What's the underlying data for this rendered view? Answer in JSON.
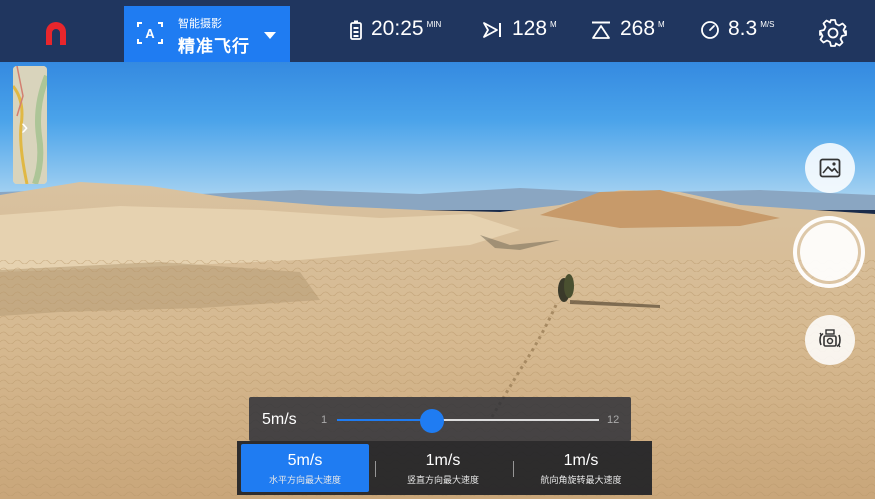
{
  "header": {
    "mode_small": "智能摄影",
    "mode_big": "精准飞行",
    "mode_icon_letter": "A",
    "battery": {
      "value": "20:25",
      "unit": "MIN",
      "icon": "battery-icon"
    },
    "distance": {
      "value": "128",
      "unit": "M",
      "icon": "distance-icon"
    },
    "altitude": {
      "value": "268",
      "unit": "M",
      "icon": "altitude-icon"
    },
    "speed": {
      "value": "8.3",
      "unit": "M/S",
      "icon": "speedometer-icon"
    }
  },
  "speed_slider": {
    "current": "5m/s",
    "min_label": "1",
    "max_label": "12",
    "min": 1,
    "max": 12,
    "value": 5
  },
  "speed_tabs": [
    {
      "value": "5m/s",
      "label": "水平方向最大速度",
      "active": true
    },
    {
      "value": "1m/s",
      "label": "竖直方向最大速度",
      "active": false
    },
    {
      "value": "1m/s",
      "label": "航向角旋转最大速度",
      "active": false
    }
  ],
  "colors": {
    "accent": "#1f7cf2",
    "topbar": "#20365f",
    "logo": "#e8262c"
  }
}
